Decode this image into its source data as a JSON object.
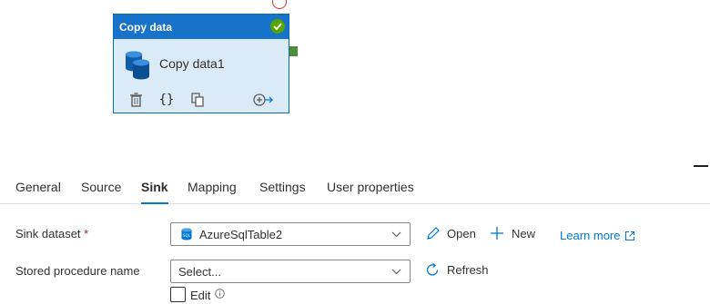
{
  "activity": {
    "type_label": "Copy data",
    "name": "Copy data1",
    "status": "succeeded",
    "colors": {
      "header": "#1772c9",
      "body": "#dbeaf7",
      "success": "#57a300",
      "port_success": "#4a8f3c",
      "port_fail": "#d13438"
    },
    "actions": [
      {
        "name": "delete-icon",
        "glyph": "trash"
      },
      {
        "name": "code-icon",
        "glyph": "{}"
      },
      {
        "name": "copy-icon",
        "glyph": "copy"
      },
      {
        "name": "add-output-icon",
        "glyph": "arrow-plus"
      }
    ]
  },
  "tabs": [
    {
      "label": "General",
      "active": false
    },
    {
      "label": "Source",
      "active": false
    },
    {
      "label": "Sink",
      "active": true
    },
    {
      "label": "Mapping",
      "active": false
    },
    {
      "label": "Settings",
      "active": false
    },
    {
      "label": "User properties",
      "active": false
    }
  ],
  "sink": {
    "dataset_label": "Sink dataset",
    "required_mark": "*",
    "dataset_value": "AzureSqlTable2",
    "open_label": "Open",
    "new_label": "New",
    "learn_more_label": "Learn more",
    "stored_procedure_label": "Stored procedure name",
    "stored_procedure_value": "Select...",
    "refresh_label": "Refresh",
    "edit_label": "Edit",
    "edit_checked": false
  },
  "accent_color": "#0078d4"
}
